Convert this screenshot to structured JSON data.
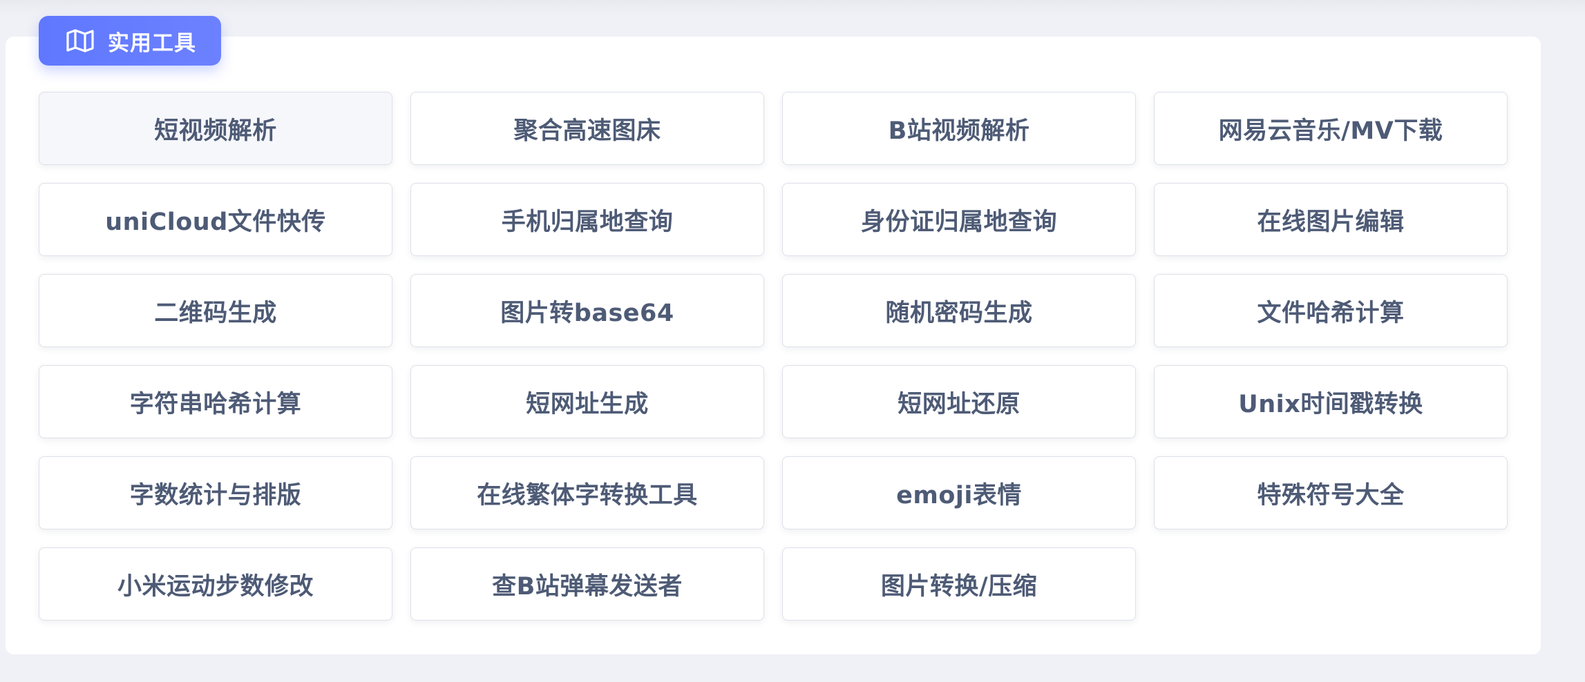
{
  "section": {
    "title": "实用工具",
    "icon": "map-icon"
  },
  "colors": {
    "accent": "#6477ff",
    "card_text": "#4e5b76",
    "page_bg": "#f0f1f6",
    "card_border": "#dde0e8"
  },
  "tools": [
    {
      "label": "短视频解析"
    },
    {
      "label": "聚合高速图床"
    },
    {
      "label": "B站视频解析"
    },
    {
      "label": "网易云音乐/MV下载"
    },
    {
      "label": "uniCloud文件快传"
    },
    {
      "label": "手机归属地查询"
    },
    {
      "label": "身份证归属地查询"
    },
    {
      "label": "在线图片编辑"
    },
    {
      "label": "二维码生成"
    },
    {
      "label": "图片转base64"
    },
    {
      "label": "随机密码生成"
    },
    {
      "label": "文件哈希计算"
    },
    {
      "label": "字符串哈希计算"
    },
    {
      "label": "短网址生成"
    },
    {
      "label": "短网址还原"
    },
    {
      "label": "Unix时间戳转换"
    },
    {
      "label": "字数统计与排版"
    },
    {
      "label": "在线繁体字转换工具"
    },
    {
      "label": "emoji表情"
    },
    {
      "label": "特殊符号大全"
    },
    {
      "label": "小米运动步数修改"
    },
    {
      "label": "查B站弹幕发送者"
    },
    {
      "label": "图片转换/压缩"
    }
  ]
}
